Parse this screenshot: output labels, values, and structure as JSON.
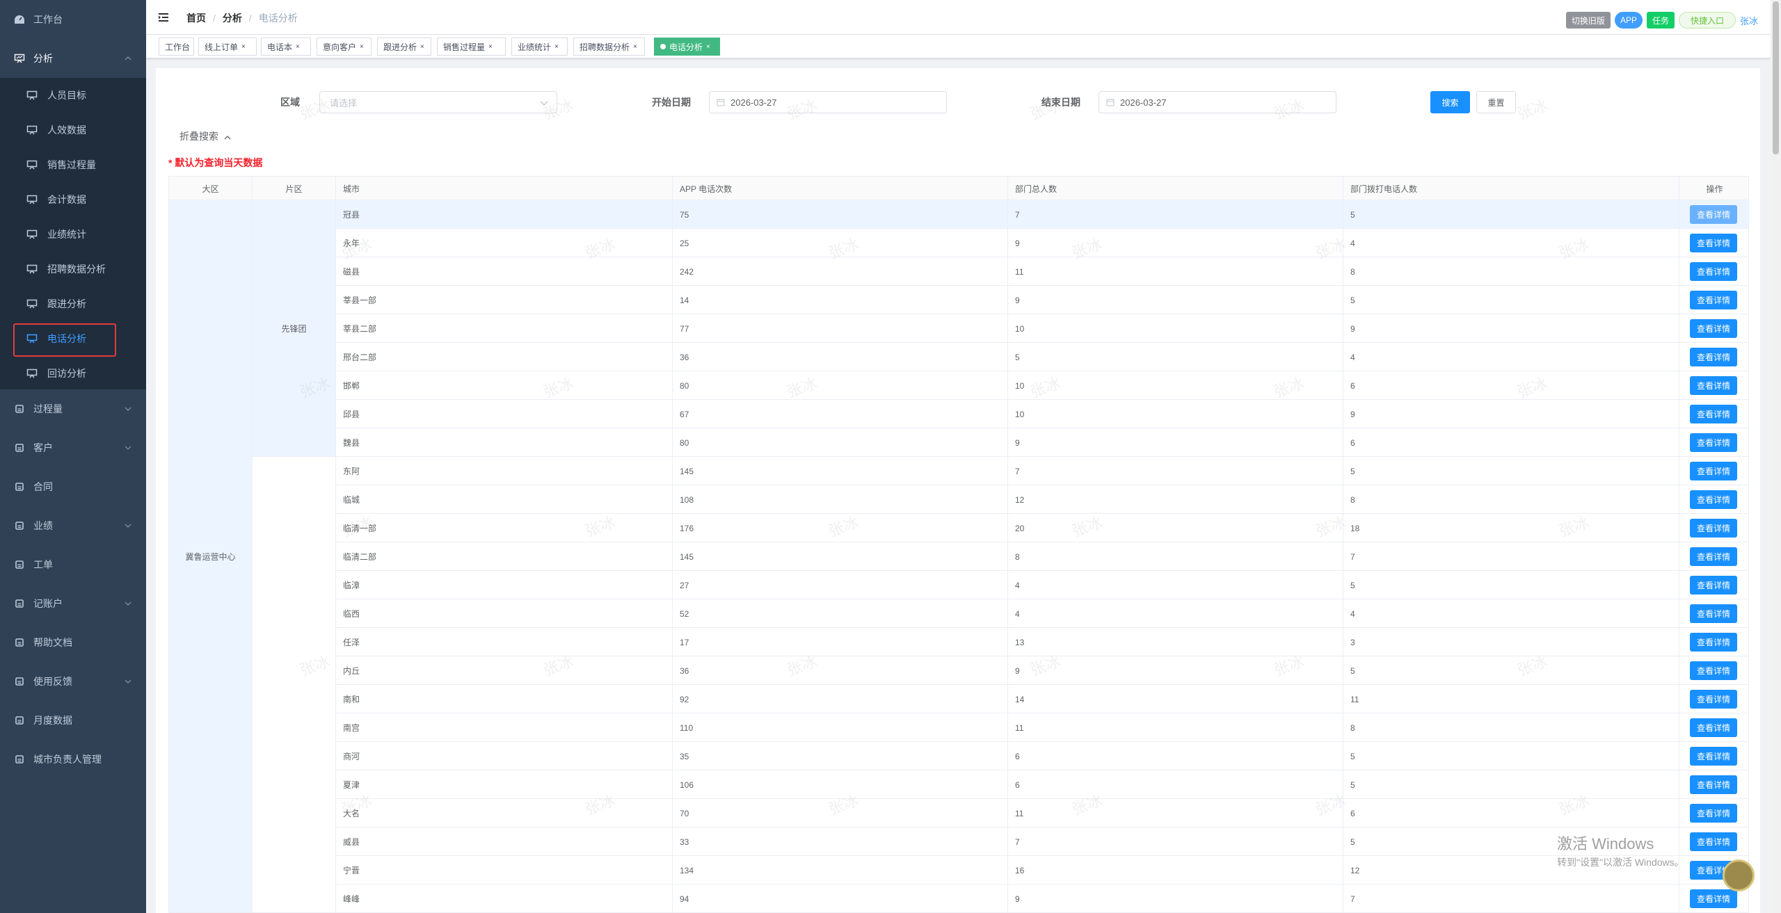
{
  "sidebar": {
    "items": [
      {
        "label": "工作台",
        "icon": "dashboard-icon"
      },
      {
        "label": "分析",
        "icon": "analysis-icon",
        "expanded": true
      },
      {
        "label": "过程量",
        "icon": "process-icon"
      },
      {
        "label": "客户",
        "icon": "user-icon"
      },
      {
        "label": "合同",
        "icon": "contract-icon"
      },
      {
        "label": "业绩",
        "icon": "performance-icon"
      },
      {
        "label": "工单",
        "icon": "clipboard-icon"
      },
      {
        "label": "记账户",
        "icon": "ledger-icon"
      },
      {
        "label": "帮助文档",
        "icon": "external-link-icon"
      },
      {
        "label": "使用反馈",
        "icon": "bug-icon"
      },
      {
        "label": "月度数据",
        "icon": "monthly-data-icon"
      },
      {
        "label": "城市负责人管理",
        "icon": "city-manager-icon"
      }
    ],
    "submenu": [
      {
        "label": "人员目标"
      },
      {
        "label": "人效数据"
      },
      {
        "label": "销售过程量"
      },
      {
        "label": "会计数据"
      },
      {
        "label": "业绩统计"
      },
      {
        "label": "招聘数据分析"
      },
      {
        "label": "跟进分析"
      },
      {
        "label": "电话分析",
        "active": true
      },
      {
        "label": "回访分析"
      }
    ]
  },
  "navbar": {
    "breadcrumb": [
      "首页",
      "分析",
      "电话分析"
    ],
    "switch_old": "切换旧版",
    "app": "APP",
    "task": "任务",
    "quick": "快捷入口",
    "user": "张冰"
  },
  "tags": [
    {
      "label": "工作台",
      "closable": false
    },
    {
      "label": "线上订单",
      "closable": true
    },
    {
      "label": "电话本",
      "closable": true
    },
    {
      "label": "意向客户",
      "closable": true
    },
    {
      "label": "跟进分析",
      "closable": true
    },
    {
      "label": "销售过程量",
      "closable": true
    },
    {
      "label": "业绩统计",
      "closable": true
    },
    {
      "label": "招聘数据分析",
      "closable": true
    },
    {
      "label": "电话分析",
      "closable": true,
      "active": true
    }
  ],
  "filters": {
    "region_label": "区域",
    "region_placeholder": "请选择",
    "start_label": "开始日期",
    "start_value": "2026-03-27",
    "end_label": "结束日期",
    "end_value": "2026-03-27",
    "search": "搜索",
    "reset": "重置",
    "fold": "折叠搜索",
    "note": "* 默认为查询当天数据"
  },
  "table": {
    "headers": [
      "大区",
      "片区",
      "城市",
      "APP 电话次数",
      "部门总人数",
      "部门拨打电话人数",
      "操作"
    ],
    "region": "冀鲁运营中心",
    "area": "先锋团",
    "action": "查看详情",
    "rows": [
      [
        "冠县",
        "75",
        "7",
        "5"
      ],
      [
        "永年",
        "25",
        "9",
        "4"
      ],
      [
        "磁县",
        "242",
        "11",
        "8"
      ],
      [
        "莘县一部",
        "14",
        "9",
        "5"
      ],
      [
        "莘县二部",
        "77",
        "10",
        "9"
      ],
      [
        "邢台二部",
        "36",
        "5",
        "4"
      ],
      [
        "邯郸",
        "80",
        "10",
        "6"
      ],
      [
        "邱县",
        "67",
        "10",
        "9"
      ],
      [
        "魏县",
        "80",
        "9",
        "6"
      ],
      [
        "东阿",
        "145",
        "7",
        "5"
      ],
      [
        "临城",
        "108",
        "12",
        "8"
      ],
      [
        "临清一部",
        "176",
        "20",
        "18"
      ],
      [
        "临清二部",
        "145",
        "8",
        "7"
      ],
      [
        "临漳",
        "27",
        "4",
        "5"
      ],
      [
        "临西",
        "52",
        "4",
        "4"
      ],
      [
        "任泽",
        "17",
        "13",
        "3"
      ],
      [
        "内丘",
        "36",
        "9",
        "5"
      ],
      [
        "南和",
        "92",
        "14",
        "11"
      ],
      [
        "南宫",
        "110",
        "11",
        "8"
      ],
      [
        "商河",
        "35",
        "6",
        "5"
      ],
      [
        "夏津",
        "106",
        "6",
        "5"
      ],
      [
        "大名",
        "70",
        "11",
        "6"
      ],
      [
        "威县",
        "33",
        "7",
        "5"
      ],
      [
        "宁晋",
        "134",
        "16",
        "12"
      ],
      [
        "峰峰",
        "94",
        "9",
        "7"
      ]
    ]
  },
  "watermark": "张冰",
  "activation": {
    "line1": "激活 Windows",
    "line2": "转到\"设置\"以激活 Windows。"
  }
}
